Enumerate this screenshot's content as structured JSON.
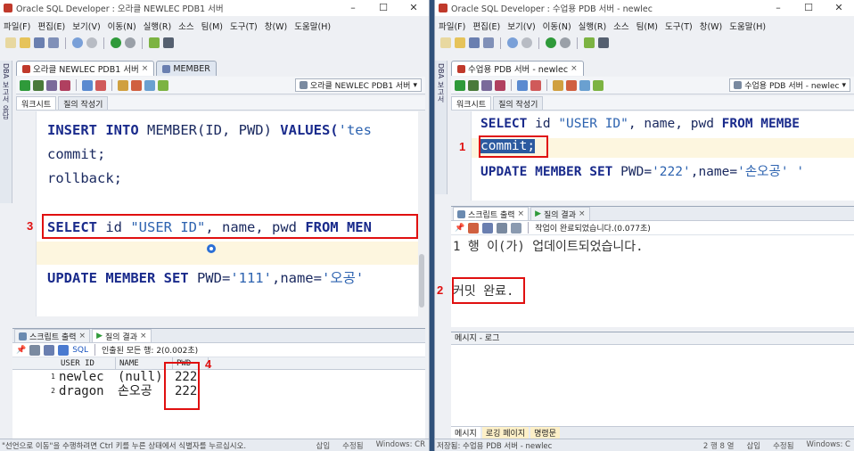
{
  "left": {
    "title": "Oracle SQL Developer : 오라클 NEWLEC PDB1 서버",
    "menu": [
      "파일(F)",
      "편집(E)",
      "보기(V)",
      "이동(N)",
      "실행(R)",
      "소스",
      "팀(M)",
      "도구(T)",
      "창(W)",
      "도움말(H)"
    ],
    "tabs": [
      "오라클 NEWLEC PDB1 서버",
      "MEMBER"
    ],
    "connection": "오라클 NEWLEC PDB1 서버",
    "subtabs": [
      "워크시트",
      "질의 작성기"
    ],
    "sidebar": [
      "DBA",
      "보고서",
      "응답"
    ],
    "code": {
      "l1a": "INSERT INTO",
      "l1b": " MEMBER(ID, PWD) ",
      "l1c": "VALUES(",
      "l1d": "'tes",
      "l2": "commit;",
      "l3": "rollback;",
      "l4a": "SELECT",
      "l4b": " id ",
      "l4c": "\"USER ID\"",
      "l4d": ", name, pwd ",
      "l4e": "FROM MEN",
      "l5a": "UPDATE MEMBER SET",
      "l5b": " PWD=",
      "l5c": "'111'",
      "l5d": ",name=",
      "l5e": "'오공'"
    },
    "marks": {
      "n3": "3",
      "n4": "4"
    },
    "output_tabs": [
      "스크립트 출력",
      "질의 결과"
    ],
    "output_toolbar": {
      "sql": "SQL",
      "status": "인출된 모든 행: 2(0.002초)"
    },
    "columns": [
      "USER ID",
      "NAME",
      "PWD"
    ],
    "rows": [
      {
        "n": "1",
        "id": "newlec",
        "name": "(null)",
        "pwd": "222"
      },
      {
        "n": "2",
        "id": "dragon",
        "name": "손오공",
        "pwd": "222"
      }
    ],
    "status": "\"선언으로 이동\"을 수행하려면 Ctrl 키를 누른 상태에서 식별자를 누르십시오.",
    "status_right": [
      "삽입",
      "수정됨",
      "Windows: CR"
    ]
  },
  "right": {
    "title": "Oracle SQL Developer : 수업용 PDB 서버 - newlec",
    "menu": [
      "파일(F)",
      "편집(E)",
      "보기(V)",
      "이동(N)",
      "실행(R)",
      "소스",
      "팀(M)",
      "도구(T)",
      "창(W)",
      "도움말(H)"
    ],
    "tabs": [
      "수업용 PDB 서버 - newlec"
    ],
    "connection": "수업용 PDB 서버 - newlec",
    "subtabs": [
      "워크시트",
      "질의 작성기"
    ],
    "sidebar": [
      "DBA",
      "보고서"
    ],
    "code": {
      "l1a": "SELECT",
      "l1b": " id ",
      "l1c": "\"USER ID\"",
      "l1d": ", name, pwd ",
      "l1e": "FROM MEMBE",
      "l2": "commit;",
      "l3a": "UPDATE MEMBER SET",
      "l3b": " PWD=",
      "l3c": "'222'",
      "l3d": ",name=",
      "l3e": "'손오공'",
      "l3f": " '"
    },
    "marks": {
      "n1": "1",
      "n2": "2"
    },
    "output_tabs": [
      "스크립트 출력",
      "질의 결과"
    ],
    "output_status": "작업이 완료되었습니다.(0.077초)",
    "output_lines": [
      "1 행 이(가) 업데이트되었습니다.",
      "커밋 완료."
    ],
    "messages_title": "메시지 - 로그",
    "bottom_tabs": [
      "메시지",
      "로깅 페이지",
      "명령문"
    ],
    "status": "저장됨: 수업용 PDB 서버 - newlec",
    "status_right": [
      "2 행 8 열",
      "삽입",
      "수정됨",
      "Windows: C"
    ]
  },
  "icons": [
    "run-icon",
    "save-icon",
    "folder-icon",
    "back-icon",
    "forward-icon",
    "close-icon",
    "minimize-icon",
    "maximize-icon",
    "pin-icon",
    "eraser-icon",
    "print-icon"
  ],
  "colors": {
    "keyword": "#1a2b8c",
    "string": "#2d63b0",
    "highlight": "#e01010",
    "selection": "#2c5aa0"
  }
}
